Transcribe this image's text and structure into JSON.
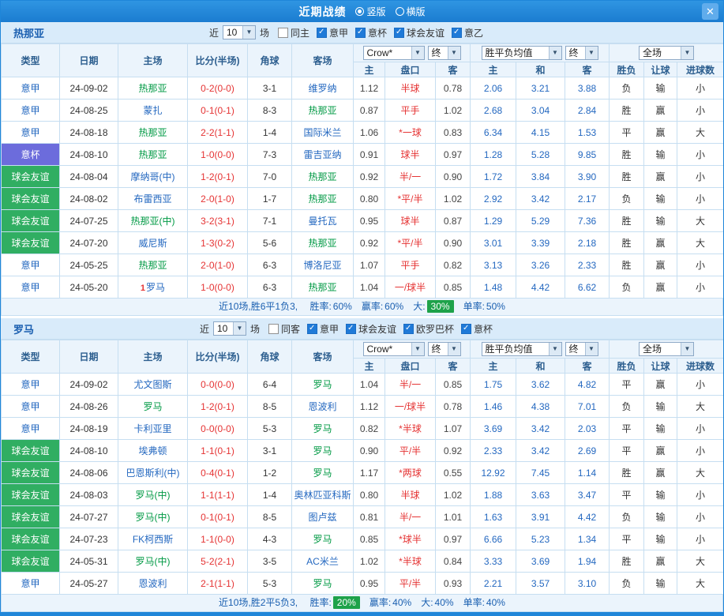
{
  "titlebar": {
    "title": "近期战绩",
    "layout_vertical": "竖版",
    "layout_horizontal": "横版",
    "close": "✕"
  },
  "table_header": {
    "type": "类型",
    "date": "日期",
    "home": "主场",
    "score": "比分(半场)",
    "corner": "角球",
    "away": "客场",
    "odds_home": "主",
    "handicap": "盘口",
    "odds_away": "客",
    "avg_home": "主",
    "avg_draw": "和",
    "avg_away": "客",
    "result": "胜负",
    "handicap_result": "让球",
    "goals": "进球数",
    "company_select": "Crow*",
    "final_select": "终",
    "avg_select": "胜平负均值",
    "scope_select": "全场"
  },
  "teams": [
    {
      "name": "热那亚",
      "filters": {
        "recent": "近",
        "count": "10",
        "unit": "场",
        "checks": [
          {
            "label": "同主",
            "checked": false
          },
          {
            "label": "意甲",
            "checked": true
          },
          {
            "label": "意杯",
            "checked": true
          },
          {
            "label": "球会友谊",
            "checked": true
          },
          {
            "label": "意乙",
            "checked": true
          }
        ]
      },
      "rows": [
        {
          "league": "意甲",
          "date": "24-09-02",
          "home": "热那亚",
          "home_focal": true,
          "score": "0-2(0-0)",
          "corners": "3-1",
          "away": "维罗纳",
          "away_focal": false,
          "odds_home": "1.12",
          "handicap": "半球",
          "odds_away": "0.78",
          "avg_home": "2.06",
          "avg_draw": "3.21",
          "avg_away": "3.88",
          "result": "负",
          "let_result": "输",
          "goal_result": "小"
        },
        {
          "league": "意甲",
          "date": "24-08-25",
          "home": "蒙扎",
          "home_focal": false,
          "score": "0-1(0-1)",
          "corners": "8-3",
          "away": "热那亚",
          "away_focal": true,
          "odds_home": "0.87",
          "handicap": "平手",
          "odds_away": "1.02",
          "avg_home": "2.68",
          "avg_draw": "3.04",
          "avg_away": "2.84",
          "result": "胜",
          "let_result": "赢",
          "goal_result": "小"
        },
        {
          "league": "意甲",
          "date": "24-08-18",
          "home": "热那亚",
          "home_focal": true,
          "score": "2-2(1-1)",
          "corners": "1-4",
          "away": "国际米兰",
          "away_focal": false,
          "odds_home": "1.06",
          "handicap": "*一球",
          "odds_away": "0.83",
          "avg_home": "6.34",
          "avg_draw": "4.15",
          "avg_away": "1.53",
          "result": "平",
          "let_result": "赢",
          "goal_result": "大"
        },
        {
          "league": "意杯",
          "date": "24-08-10",
          "home": "热那亚",
          "home_focal": true,
          "score": "1-0(0-0)",
          "corners": "7-3",
          "away": "雷吉亚纳",
          "away_focal": false,
          "odds_home": "0.91",
          "handicap": "球半",
          "odds_away": "0.97",
          "avg_home": "1.28",
          "avg_draw": "5.28",
          "avg_away": "9.85",
          "result": "胜",
          "let_result": "输",
          "goal_result": "小"
        },
        {
          "league": "球会友谊",
          "date": "24-08-04",
          "home": "摩纳哥(中)",
          "home_focal": false,
          "score": "1-2(0-1)",
          "corners": "7-0",
          "away": "热那亚",
          "away_focal": true,
          "odds_home": "0.92",
          "handicap": "半/一",
          "odds_away": "0.90",
          "avg_home": "1.72",
          "avg_draw": "3.84",
          "avg_away": "3.90",
          "result": "胜",
          "let_result": "赢",
          "goal_result": "小"
        },
        {
          "league": "球会友谊",
          "date": "24-08-02",
          "home": "布雷西亚",
          "home_focal": false,
          "score": "2-0(1-0)",
          "corners": "1-7",
          "away": "热那亚",
          "away_focal": true,
          "odds_home": "0.80",
          "handicap": "*平/半",
          "odds_away": "1.02",
          "avg_home": "2.92",
          "avg_draw": "3.42",
          "avg_away": "2.17",
          "result": "负",
          "let_result": "输",
          "goal_result": "小"
        },
        {
          "league": "球会友谊",
          "date": "24-07-25",
          "home": "热那亚(中)",
          "home_focal": true,
          "score": "3-2(3-1)",
          "corners": "7-1",
          "away": "曼托瓦",
          "away_focal": false,
          "odds_home": "0.95",
          "handicap": "球半",
          "odds_away": "0.87",
          "avg_home": "1.29",
          "avg_draw": "5.29",
          "avg_away": "7.36",
          "result": "胜",
          "let_result": "输",
          "goal_result": "大"
        },
        {
          "league": "球会友谊",
          "date": "24-07-20",
          "home": "威尼斯",
          "home_focal": false,
          "score": "1-3(0-2)",
          "corners": "5-6",
          "away": "热那亚",
          "away_focal": true,
          "odds_home": "0.92",
          "handicap": "*平/半",
          "odds_away": "0.90",
          "avg_home": "3.01",
          "avg_draw": "3.39",
          "avg_away": "2.18",
          "result": "胜",
          "let_result": "赢",
          "goal_result": "大"
        },
        {
          "league": "意甲",
          "date": "24-05-25",
          "home": "热那亚",
          "home_focal": true,
          "score": "2-0(1-0)",
          "corners": "6-3",
          "away": "博洛尼亚",
          "away_focal": false,
          "odds_home": "1.07",
          "handicap": "平手",
          "odds_away": "0.82",
          "avg_home": "3.13",
          "avg_draw": "3.26",
          "avg_away": "2.33",
          "result": "胜",
          "let_result": "赢",
          "goal_result": "小"
        },
        {
          "league": "意甲",
          "date": "24-05-20",
          "home": "罗马",
          "home_focal": false,
          "home_badge": "1",
          "score": "1-0(0-0)",
          "corners": "6-3",
          "away": "热那亚",
          "away_focal": true,
          "odds_home": "1.04",
          "handicap": "一/球半",
          "odds_away": "0.85",
          "avg_home": "1.48",
          "avg_draw": "4.42",
          "avg_away": "6.62",
          "result": "负",
          "let_result": "赢",
          "goal_result": "小"
        }
      ],
      "footer": {
        "summary": "近10场,胜6平1负3,",
        "stats": [
          {
            "label": "胜率:",
            "value": "60%",
            "badge": false
          },
          {
            "label": "赢率:",
            "value": "60%",
            "badge": false
          },
          {
            "label": "大:",
            "value": "30%",
            "badge": true
          },
          {
            "label": "单率:",
            "value": "50%",
            "badge": false
          }
        ]
      }
    },
    {
      "name": "罗马",
      "filters": {
        "recent": "近",
        "count": "10",
        "unit": "场",
        "checks": [
          {
            "label": "同客",
            "checked": false
          },
          {
            "label": "意甲",
            "checked": true
          },
          {
            "label": "球会友谊",
            "checked": true
          },
          {
            "label": "欧罗巴杯",
            "checked": true
          },
          {
            "label": "意杯",
            "checked": true
          }
        ]
      },
      "rows": [
        {
          "league": "意甲",
          "date": "24-09-02",
          "home": "尤文图斯",
          "home_focal": false,
          "score": "0-0(0-0)",
          "corners": "6-4",
          "away": "罗马",
          "away_focal": true,
          "odds_home": "1.04",
          "handicap": "半/一",
          "odds_away": "0.85",
          "avg_home": "1.75",
          "avg_draw": "3.62",
          "avg_away": "4.82",
          "result": "平",
          "let_result": "赢",
          "goal_result": "小"
        },
        {
          "league": "意甲",
          "date": "24-08-26",
          "home": "罗马",
          "home_focal": true,
          "score": "1-2(0-1)",
          "corners": "8-5",
          "away": "恩波利",
          "away_focal": false,
          "odds_home": "1.12",
          "handicap": "一/球半",
          "odds_away": "0.78",
          "avg_home": "1.46",
          "avg_draw": "4.38",
          "avg_away": "7.01",
          "result": "负",
          "let_result": "输",
          "goal_result": "大"
        },
        {
          "league": "意甲",
          "date": "24-08-19",
          "home": "卡利亚里",
          "home_focal": false,
          "score": "0-0(0-0)",
          "corners": "5-3",
          "away": "罗马",
          "away_focal": true,
          "odds_home": "0.82",
          "handicap": "*半球",
          "odds_away": "1.07",
          "avg_home": "3.69",
          "avg_draw": "3.42",
          "avg_away": "2.03",
          "result": "平",
          "let_result": "输",
          "goal_result": "小"
        },
        {
          "league": "球会友谊",
          "date": "24-08-10",
          "home": "埃弗顿",
          "home_focal": false,
          "score": "1-1(0-1)",
          "corners": "3-1",
          "away": "罗马",
          "away_focal": true,
          "odds_home": "0.90",
          "handicap": "平/半",
          "odds_away": "0.92",
          "avg_home": "2.33",
          "avg_draw": "3.42",
          "avg_away": "2.69",
          "result": "平",
          "let_result": "赢",
          "goal_result": "小"
        },
        {
          "league": "球会友谊",
          "date": "24-08-06",
          "home": "巴恩斯利(中)",
          "home_focal": false,
          "score": "0-4(0-1)",
          "corners": "1-2",
          "away": "罗马",
          "away_focal": true,
          "odds_home": "1.17",
          "handicap": "*两球",
          "odds_away": "0.55",
          "avg_home": "12.92",
          "avg_draw": "7.45",
          "avg_away": "1.14",
          "result": "胜",
          "let_result": "赢",
          "goal_result": "大"
        },
        {
          "league": "球会友谊",
          "date": "24-08-03",
          "home": "罗马(中)",
          "home_focal": true,
          "score": "1-1(1-1)",
          "corners": "1-4",
          "away": "奥林匹亚科斯",
          "away_focal": false,
          "odds_home": "0.80",
          "handicap": "半球",
          "odds_away": "1.02",
          "avg_home": "1.88",
          "avg_draw": "3.63",
          "avg_away": "3.47",
          "result": "平",
          "let_result": "输",
          "goal_result": "小"
        },
        {
          "league": "球会友谊",
          "date": "24-07-27",
          "home": "罗马(中)",
          "home_focal": true,
          "score": "0-1(0-1)",
          "corners": "8-5",
          "away": "图卢兹",
          "away_focal": false,
          "odds_home": "0.81",
          "handicap": "半/一",
          "odds_away": "1.01",
          "avg_home": "1.63",
          "avg_draw": "3.91",
          "avg_away": "4.42",
          "result": "负",
          "let_result": "输",
          "goal_result": "小"
        },
        {
          "league": "球会友谊",
          "date": "24-07-23",
          "home": "FK柯西斯",
          "home_focal": false,
          "score": "1-1(0-0)",
          "corners": "4-3",
          "away": "罗马",
          "away_focal": true,
          "odds_home": "0.85",
          "handicap": "*球半",
          "odds_away": "0.97",
          "avg_home": "6.66",
          "avg_draw": "5.23",
          "avg_away": "1.34",
          "result": "平",
          "let_result": "输",
          "goal_result": "小"
        },
        {
          "league": "球会友谊",
          "date": "24-05-31",
          "home": "罗马(中)",
          "home_focal": true,
          "score": "5-2(2-1)",
          "corners": "3-5",
          "away": "AC米兰",
          "away_focal": false,
          "odds_home": "1.02",
          "handicap": "*半球",
          "odds_away": "0.84",
          "avg_home": "3.33",
          "avg_draw": "3.69",
          "avg_away": "1.94",
          "result": "胜",
          "let_result": "赢",
          "goal_result": "大"
        },
        {
          "league": "意甲",
          "date": "24-05-27",
          "home": "恩波利",
          "home_focal": false,
          "score": "2-1(1-1)",
          "corners": "5-3",
          "away": "罗马",
          "away_focal": true,
          "odds_home": "0.95",
          "handicap": "平/半",
          "odds_away": "0.93",
          "avg_home": "2.21",
          "avg_draw": "3.57",
          "avg_away": "3.10",
          "result": "负",
          "let_result": "输",
          "goal_result": "大"
        }
      ],
      "footer": {
        "summary": "近10场,胜2平5负3,",
        "stats": [
          {
            "label": "胜率:",
            "value": "20%",
            "badge": true
          },
          {
            "label": "赢率:",
            "value": "40%",
            "badge": false
          },
          {
            "label": "大:",
            "value": "40%",
            "badge": false
          },
          {
            "label": "单率:",
            "value": "40%",
            "badge": false
          }
        ]
      }
    }
  ]
}
